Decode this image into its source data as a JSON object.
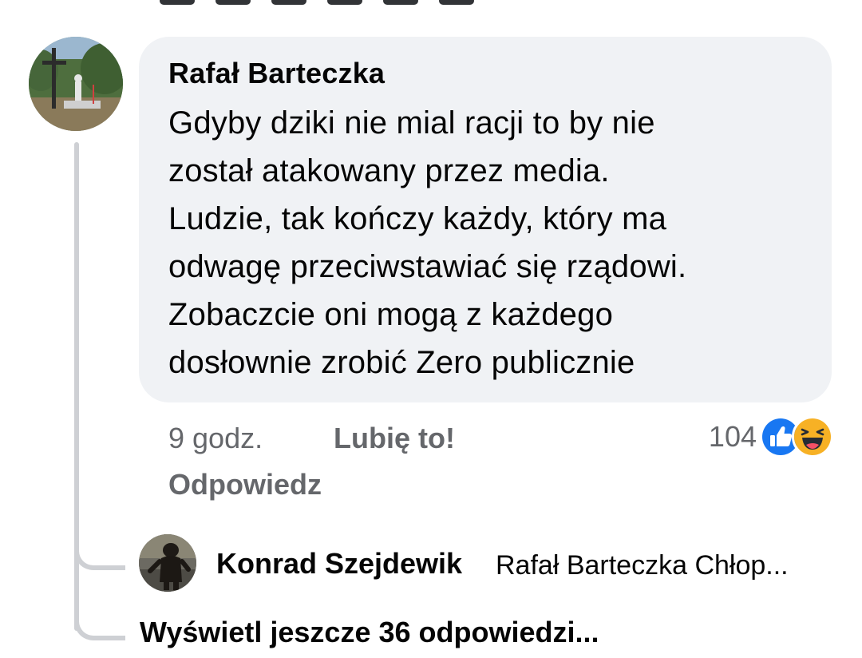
{
  "comment": {
    "author": "Rafał Barteczka",
    "text": "Gdyby dziki nie mial racji to by nie\nzostał atakowany przez media.\nLudzie, tak kończy każdy, który ma\nodwagę przeciwstawiać się rządowi.\nZobaczcie oni mogą z każdego\ndosłownie zrobić Zero publicznie",
    "time": "9 godz.",
    "like_label": "Lubię to!",
    "reply_label": "Odpowiedz",
    "reaction_count": "104",
    "reactions": [
      "like-icon",
      "haha-icon"
    ]
  },
  "reply": {
    "author": "Konrad Szejdewik",
    "snippet": "Rafał Barteczka Chłop..."
  },
  "view_more_label": "Wyświetl jeszcze 36 odpowiedzi...",
  "colors": {
    "bubble": "#f0f2f5",
    "meta_text": "#65676b",
    "thread_line": "#ced0d4",
    "like_blue": "#1877f2",
    "haha_yellow": "#f7b125"
  }
}
